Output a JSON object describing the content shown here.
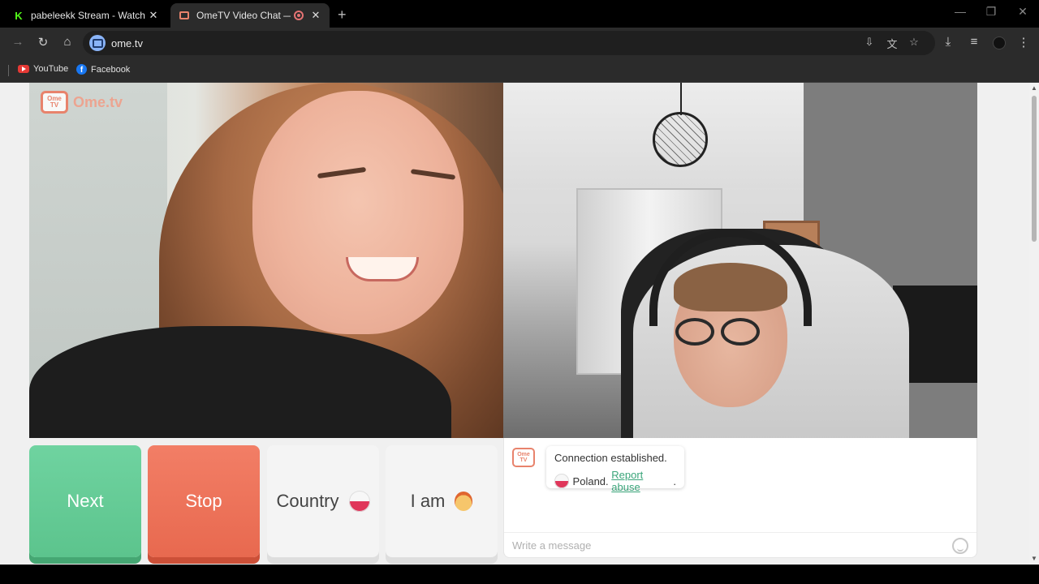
{
  "tabs": [
    {
      "title": "pabeleekk Stream - Watch Live",
      "close": "✕"
    },
    {
      "title": "OmeTV Video Chat — Omegle",
      "close": "✕"
    }
  ],
  "new_tab": "+",
  "window_controls": {
    "minimize": "—",
    "maximize": "❐",
    "close": "✕"
  },
  "toolbar": {
    "back": "→",
    "reload": "↻",
    "home": "⌂",
    "url": "ome.tv",
    "icons": [
      "install-icon",
      "translate-icon",
      "star-icon",
      "download-icon",
      "media-icon",
      "profile-icon",
      "menu-icon"
    ]
  },
  "bookmarks": [
    {
      "label": "YouTube",
      "icon": "youtube-icon"
    },
    {
      "label": "Facebook",
      "icon": "facebook-icon"
    }
  ],
  "page": {
    "logo_badge": "Ome TV",
    "logo_text": "Ome.tv",
    "buttons": {
      "next": "Next",
      "stop": "Stop",
      "country": "Country",
      "iam": "I am"
    },
    "chat": {
      "logo_badge": "Ome TV",
      "message_line1": "Connection established.",
      "country": "Poland.",
      "report_link": "Report abuse",
      "report_suffix": ".",
      "input_placeholder": "Write a message"
    }
  },
  "colors": {
    "next": "#5cc48d",
    "stop": "#e8694f",
    "accent_link": "#3aa57a",
    "brand": "#e8836c"
  }
}
